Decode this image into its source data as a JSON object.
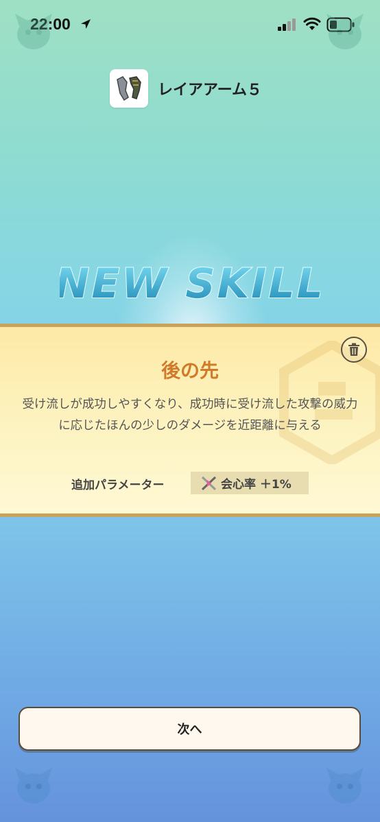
{
  "status_bar": {
    "time": "22:00",
    "icons": [
      "location-arrow-icon",
      "cellular-signal-icon",
      "wifi-icon",
      "battery-icon"
    ]
  },
  "item": {
    "name": "レイアアーム５",
    "icon": "arm-armor-icon"
  },
  "banner": {
    "title": "NEW SKILL"
  },
  "skill": {
    "name": "後の先",
    "description": "受け流しが成功しやすくなり、成功時に受け流した攻撃の威力に応じたほんの少しのダメージを近距離に与える",
    "param_label": "追加パラメーター",
    "param_value": "会心率 ＋1%",
    "param_icon": "critical-swords-icon",
    "delete_icon": "trash-icon"
  },
  "actions": {
    "next_label": "次へ"
  },
  "colors": {
    "skill_name": "#d07a2a",
    "card_border": "#c9a35c",
    "banner_text": "#2a9fc4"
  }
}
